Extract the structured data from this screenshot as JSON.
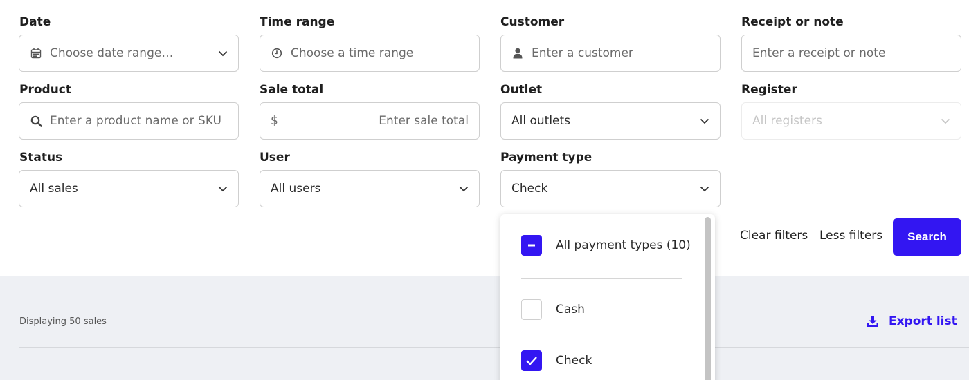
{
  "filters": {
    "date": {
      "label": "Date",
      "placeholder": "Choose date range…"
    },
    "time_range": {
      "label": "Time range",
      "placeholder": "Choose a time range"
    },
    "customer": {
      "label": "Customer",
      "placeholder": "Enter a customer"
    },
    "receipt": {
      "label": "Receipt or note",
      "placeholder": "Enter a receipt or note"
    },
    "product": {
      "label": "Product",
      "placeholder": "Enter a product name or SKU"
    },
    "sale_total": {
      "label": "Sale total",
      "currency": "$",
      "placeholder": "Enter sale total"
    },
    "outlet": {
      "label": "Outlet",
      "value": "All outlets"
    },
    "register": {
      "label": "Register",
      "placeholder": "All registers"
    },
    "status": {
      "label": "Status",
      "value": "All sales"
    },
    "user": {
      "label": "User",
      "value": "All users"
    },
    "payment_type": {
      "label": "Payment type",
      "value": "Check"
    }
  },
  "actions": {
    "clear_filters": "Clear filters",
    "less_filters": "Less filters",
    "search": "Search"
  },
  "results": {
    "displaying": "Displaying 50 sales",
    "export": "Export list"
  },
  "payment_dropdown": {
    "items": [
      {
        "label": "All payment types (10)",
        "state": "indeterminate"
      },
      {
        "label": "Cash",
        "state": "unchecked"
      },
      {
        "label": "Check",
        "state": "checked"
      }
    ]
  },
  "colors": {
    "accent": "#3316f2",
    "band": "#eef0f4"
  }
}
